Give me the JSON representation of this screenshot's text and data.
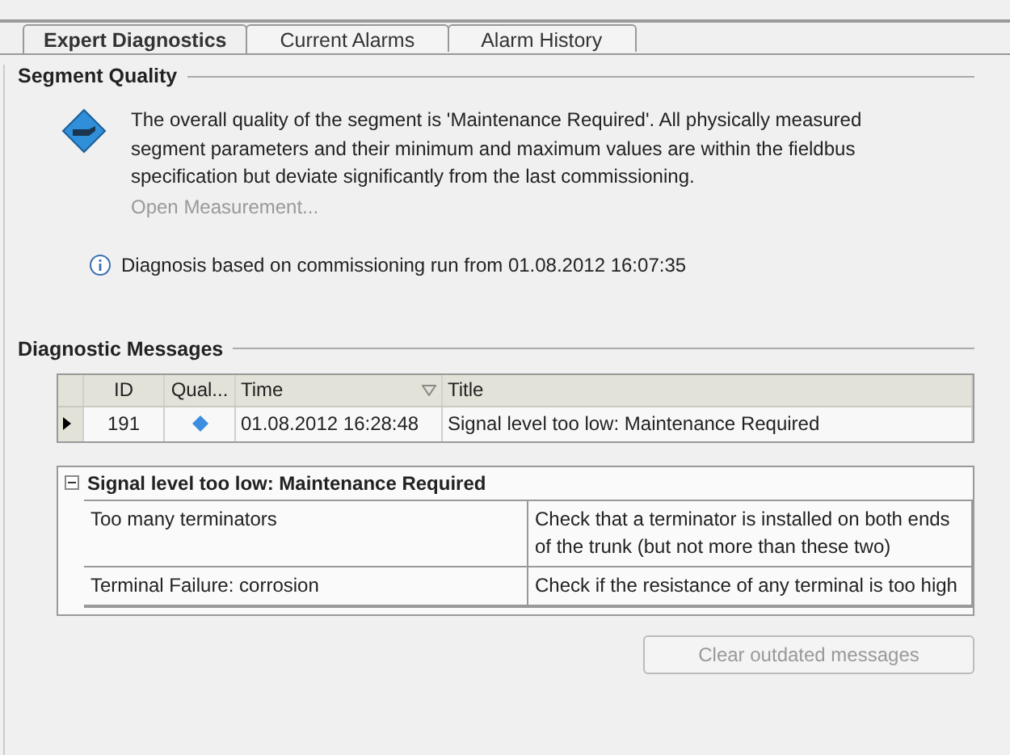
{
  "tabs": [
    {
      "label": "Expert Diagnostics",
      "selected": true
    },
    {
      "label": "Current Alarms",
      "selected": false
    },
    {
      "label": "Alarm History",
      "selected": false
    }
  ],
  "segment_quality": {
    "heading": "Segment Quality",
    "message": "The overall quality of the segment is 'Maintenance Required'. All physically measured segment parameters and their minimum and maximum values are within the fieldbus specification but deviate significantly from the last commissioning.",
    "link": {
      "label": "Open Measurement...",
      "disabled": true
    },
    "note": "Diagnosis based on commissioning run from 01.08.2012 16:07:35"
  },
  "diagnostic_messages": {
    "heading": "Diagnostic Messages",
    "columns": [
      {
        "label": "ID",
        "sorted": false
      },
      {
        "label": "Qual...",
        "sorted": false
      },
      {
        "label": "Time",
        "sorted": true
      },
      {
        "label": "Title",
        "sorted": false
      }
    ],
    "rows": [
      {
        "id": "191",
        "time": "01.08.2012 16:28:48",
        "title": "Signal level too low: Maintenance Required",
        "current": true
      }
    ],
    "detail": {
      "title": "Signal level too low: Maintenance Required",
      "expanded": true,
      "rows": [
        {
          "cause": "Too many terminators",
          "remedy": "Check that a terminator is installed on both ends of the trunk (but not more than these two)"
        },
        {
          "cause": "Terminal Failure: corrosion",
          "remedy": "Check if the resistance of any terminal is too high"
        }
      ]
    },
    "button": {
      "label": "Clear outdated messages",
      "disabled": true
    }
  }
}
